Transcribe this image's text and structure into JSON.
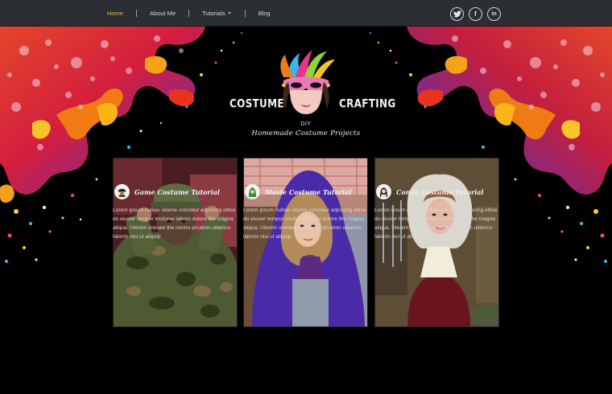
{
  "nav": {
    "items": [
      {
        "label": "Home",
        "active": true
      },
      {
        "label": "About Me"
      },
      {
        "label": "Tutorials",
        "has_dropdown": true
      },
      {
        "label": "Blog"
      }
    ],
    "social": [
      "twitter-icon",
      "facebook-icon",
      "linkedin-icon"
    ],
    "social_glyphs": {
      "twitter": "t",
      "facebook": "f",
      "linkedin": "in"
    }
  },
  "hero": {
    "brand_left": "COSTUME",
    "brand_right": "CRAFTING",
    "diy": "DIY",
    "tagline": "Homemade Costume Projects"
  },
  "cards": [
    {
      "title": "Game Costume Tutorial",
      "icon": "soldier-icon",
      "text": "Lorem ipsum nullaw sitame consteur adpscing elitse do eiuswr tempor incdunw labore dolore the magna aliqua. Utenim vrenaw the nostru prcation ullamco laboris nisi ut aliquip"
    },
    {
      "title": "Movie Costume Tutorial",
      "icon": "hood-icon",
      "text": "Lorem ipsum nullaw sitame consteur adpscing elitse do eiuswr tempor incdunw labore dolore the magna aliqua. Utenim vrenaw the nostru prcation ullamco laboris nisi ut aliquip"
    },
    {
      "title": "Comic Costume Tutorial",
      "icon": "lady-icon",
      "text": "Lorem ipsum nullaw sitame consteur adpscing elitse do eiuswr tempor incdunw labore dolore the magna aliqua. Utenim vrenaw the nostru prcation ullamco laboris nisi ut aliquip"
    }
  ],
  "colors": {
    "nav_bg": "#2b2e33",
    "active": "#f0b14a",
    "page_bg": "#000000",
    "mask": "#e87ab8"
  }
}
